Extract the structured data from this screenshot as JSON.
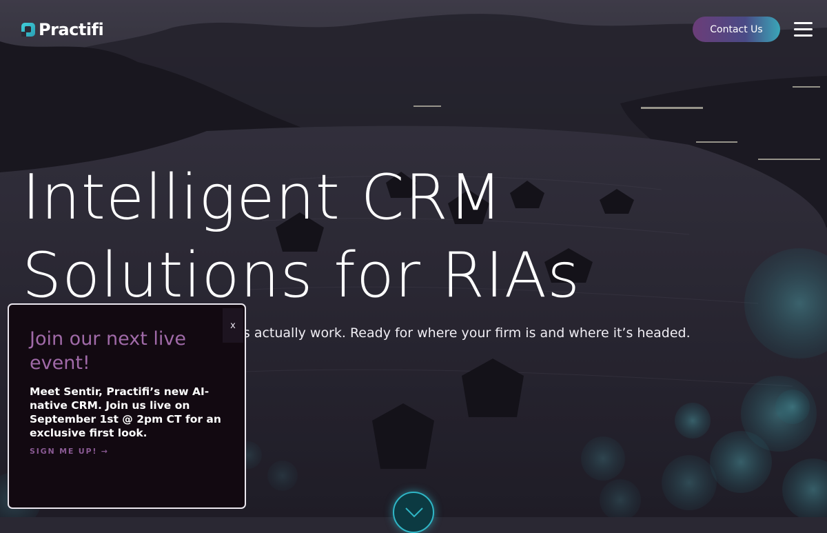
{
  "header": {
    "logo_text": "Practifi",
    "contact_label": "Contact Us",
    "menu_icon": "hamburger-menu-icon"
  },
  "hero": {
    "title": "Intelligent CRM Solutions for RIAs",
    "subtitle": "A CRM built around how your firms actually work. Ready for where your firm is and where it’s headed."
  },
  "popup": {
    "close_label": "x",
    "title": "Join our next live event!",
    "body": "Meet Sentir, Practifi’s new AI-native CRM. Join us live on September 1st @ 2pm CT for an exclusive first look.",
    "cta_label": "SIGN ME UP! →"
  },
  "scroll": {
    "icon": "chevron-down-icon"
  },
  "colors": {
    "accent_purple": "#a06aa8",
    "accent_teal": "#2fb6c6",
    "popup_bg": "#120911"
  }
}
